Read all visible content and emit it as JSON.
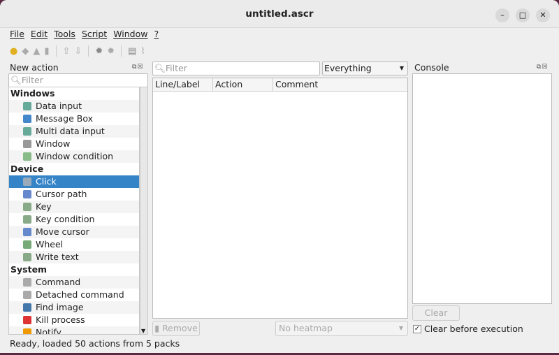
{
  "window": {
    "title": "untitled.ascr",
    "minimize": "–",
    "maximize": "□",
    "close": "✕"
  },
  "menu": [
    "File",
    "Edit",
    "Tools",
    "Script",
    "Window",
    "?"
  ],
  "new_action": {
    "title": "New action",
    "filter_placeholder": "Filter",
    "groups": [
      {
        "label": "Windows",
        "items": [
          "Data input",
          "Message Box",
          "Multi data input",
          "Window",
          "Window condition"
        ]
      },
      {
        "label": "Device",
        "items": [
          "Click",
          "Cursor path",
          "Key",
          "Key condition",
          "Move cursor",
          "Wheel",
          "Write text"
        ]
      },
      {
        "label": "System",
        "items": [
          "Command",
          "Detached command",
          "Find image",
          "Kill process",
          "Notify"
        ]
      }
    ],
    "selected": "Click"
  },
  "script": {
    "filter_placeholder": "Filter",
    "scope": "Everything",
    "columns": [
      "Line/Label",
      "Action",
      "Comment"
    ],
    "remove_label": "Remove",
    "heatmap": "No heatmap"
  },
  "console": {
    "title": "Console",
    "clear_label": "Clear",
    "clear_before_execution_label": "Clear before execution",
    "clear_before_execution": true
  },
  "status": "Ready, loaded 50 actions from 5 packs",
  "colors": {
    "selection": "#3584c8"
  }
}
